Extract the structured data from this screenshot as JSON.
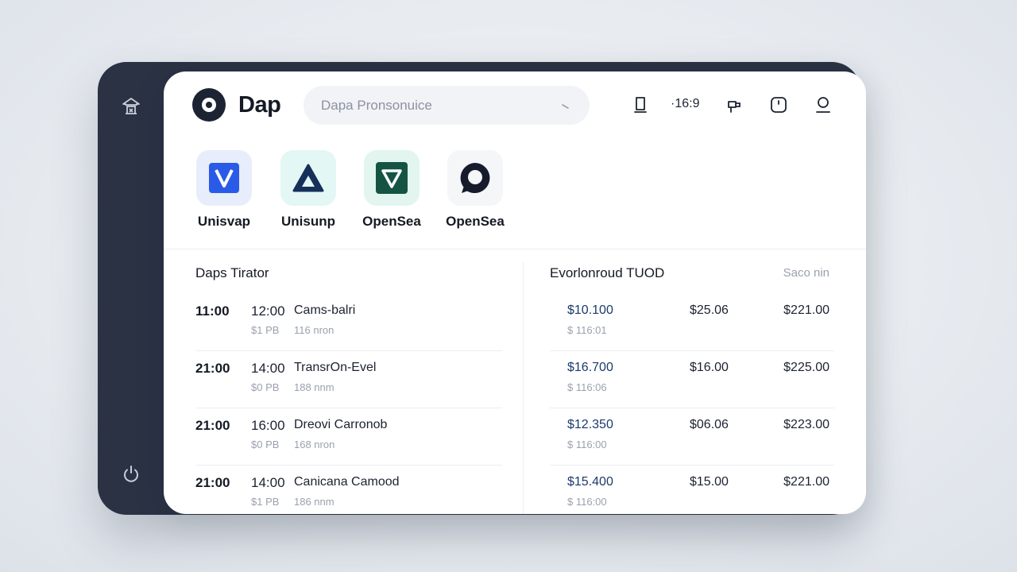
{
  "header": {
    "title": "Dap",
    "search_placeholder": "Dapa Pronsonuice",
    "zoom_label": "·16:9"
  },
  "apps": [
    {
      "label": "Unisvap",
      "icon": "v-logo-icon",
      "bg": "#e8edfb",
      "fg": "#2a5be8"
    },
    {
      "label": "Unisunp",
      "icon": "triangle-logo-icon",
      "bg": "#e3f7f5",
      "fg": "#16305a"
    },
    {
      "label": "OpenSea",
      "icon": "down-triangle-logo-icon",
      "bg": "#e2f5ef",
      "fg": "#155443"
    },
    {
      "label": "OpenSea",
      "icon": "chat-bubble-logo-icon",
      "bg": "#f5f6f8",
      "fg": "#161c2c"
    }
  ],
  "left_panel": {
    "title": "Daps Tirator",
    "rows": [
      {
        "time1": "11:00",
        "time2": "12:00",
        "name": "Cams-balri",
        "sub1": "$1 PB",
        "sub2": "116 nron"
      },
      {
        "time1": "21:00",
        "time2": "14:00",
        "name": "TransrOn-Evel",
        "sub1": "$0 PB",
        "sub2": "188 nnm"
      },
      {
        "time1": "21:00",
        "time2": "16:00",
        "name": "Dreovi Carronob",
        "sub1": "$0 PB",
        "sub2": "168 nron"
      },
      {
        "time1": "21:00",
        "time2": "14:00",
        "name": "Canicana Camood",
        "sub1": "$1 PB",
        "sub2": "186 nnm"
      }
    ]
  },
  "right_panel": {
    "title": "Evorlonroud TUOD",
    "aux": "Saco nin",
    "rows": [
      {
        "p1": "$10.100",
        "p1_sub": "$ 116:01",
        "p2": "$25.06",
        "p3": "$221.00"
      },
      {
        "p1": "$16.700",
        "p1_sub": "$ 116:06",
        "p2": "$16.00",
        "p3": "$225.00"
      },
      {
        "p1": "$12.350",
        "p1_sub": "$ 116:00",
        "p2": "$06.06",
        "p3": "$223.00"
      },
      {
        "p1": "$15.400",
        "p1_sub": "$ 116:00",
        "p2": "$15.00",
        "p3": "$221.00"
      }
    ]
  },
  "colors": {
    "rail": "#2a3244",
    "card": "#ffffff",
    "accent_price": "#1b3a6b"
  }
}
